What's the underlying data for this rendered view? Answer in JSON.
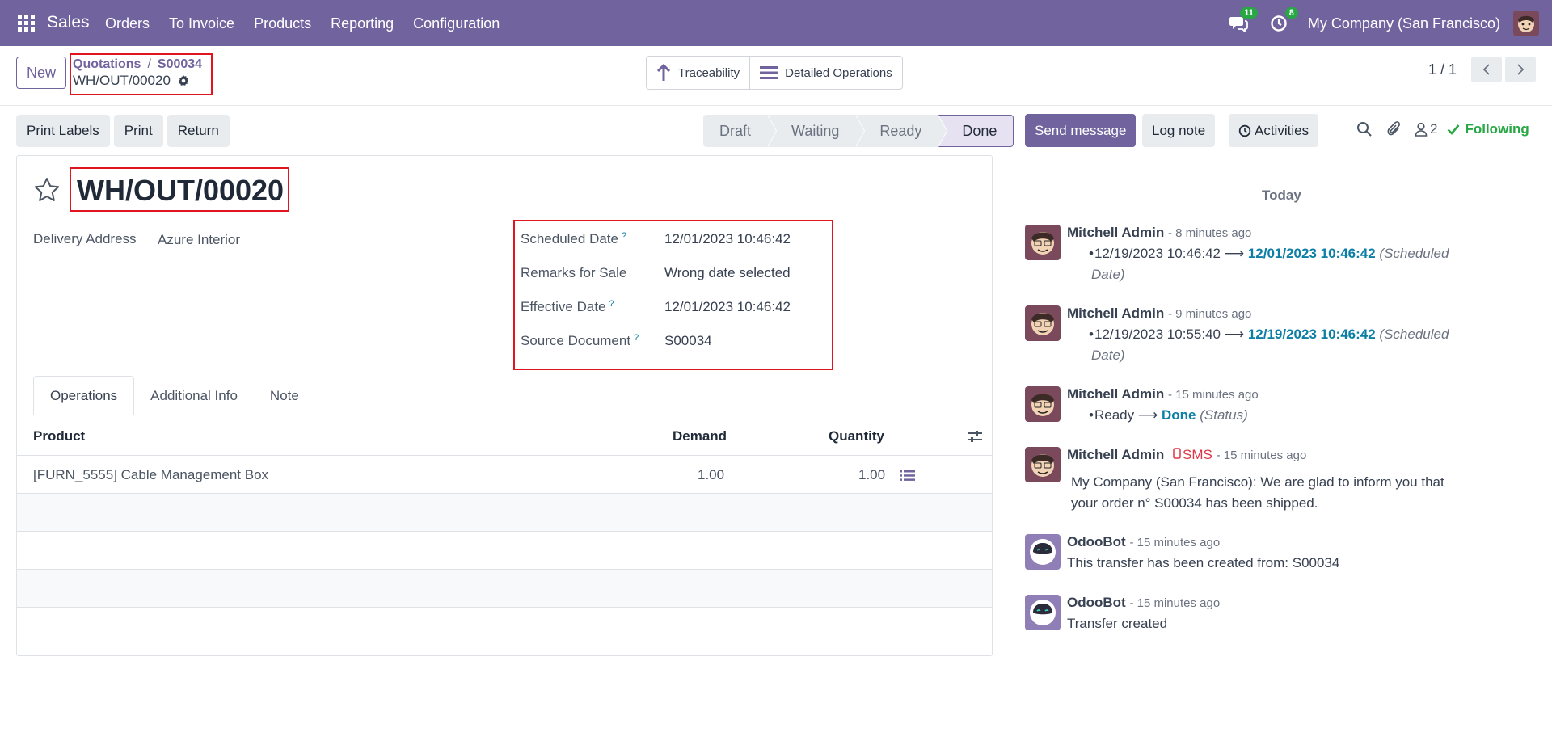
{
  "navbar": {
    "app_name": "Sales",
    "menu": [
      "Orders",
      "To Invoice",
      "Products",
      "Reporting",
      "Configuration"
    ],
    "messages_badge": "11",
    "activities_badge": "8",
    "company": "My Company (San Francisco)"
  },
  "control": {
    "new_label": "New",
    "breadcrumb_parent": "Quotations",
    "breadcrumb_sep": "/",
    "breadcrumb_order": "S00034",
    "record_name": "WH/OUT/00020",
    "traceability_label": "Traceability",
    "detailed_ops_label": "Detailed Operations",
    "pager": "1 / 1"
  },
  "actions": {
    "print_labels": "Print Labels",
    "print": "Print",
    "return": "Return"
  },
  "status": {
    "stages": [
      "Draft",
      "Waiting",
      "Ready",
      "Done"
    ],
    "current": "Done"
  },
  "form": {
    "title": "WH/OUT/00020",
    "delivery_address_label": "Delivery Address",
    "delivery_address_value": "Azure Interior",
    "scheduled_date_label": "Scheduled Date",
    "scheduled_date_value": "12/01/2023 10:46:42",
    "remarks_label": "Remarks for Sale",
    "remarks_value": "Wrong date selected",
    "effective_date_label": "Effective Date",
    "effective_date_value": "12/01/2023 10:46:42",
    "source_document_label": "Source Document",
    "source_document_value": "S00034",
    "help_mark": "?"
  },
  "tabs": [
    "Operations",
    "Additional Info",
    "Note"
  ],
  "table": {
    "headers": {
      "product": "Product",
      "demand": "Demand",
      "quantity": "Quantity"
    },
    "rows": [
      {
        "product": "[FURN_5555] Cable Management Box",
        "demand": "1.00",
        "quantity": "1.00"
      }
    ]
  },
  "chatter": {
    "send_message": "Send message",
    "log_note": "Log note",
    "activities": "Activities",
    "followers_count": "2",
    "following": "Following",
    "today": "Today",
    "messages": [
      {
        "author": "Mitchell Admin",
        "time": "- 8 minutes ago",
        "old": "12/19/2023 10:46:42",
        "arrow": "⟶",
        "new": "12/01/2023 10:46:42",
        "field": "(Scheduled",
        "field2": "Date)"
      },
      {
        "author": "Mitchell Admin",
        "time": "- 9 minutes ago",
        "old": "12/19/2023 10:55:40",
        "arrow": "⟶",
        "new": "12/19/2023 10:46:42",
        "field": "(Scheduled",
        "field2": "Date)"
      },
      {
        "author": "Mitchell Admin",
        "time": "- 15 minutes ago",
        "old": "Ready",
        "arrow": "⟶",
        "new": "Done",
        "field": "(Status)"
      },
      {
        "author": "Mitchell Admin",
        "sms": "SMS",
        "time": "- 15 minutes ago",
        "body1": "My Company (San Francisco): We are glad to inform you that",
        "body2": "your order n° S00034 has been shipped."
      },
      {
        "author": "OdooBot",
        "time": "- 15 minutes ago",
        "body_prefix": "This transfer has been created from: ",
        "body_link": "S00034"
      },
      {
        "author": "OdooBot",
        "time": "- 15 minutes ago",
        "body1": "Transfer created"
      }
    ]
  },
  "colors": {
    "brand": "#71639e",
    "highlight_box": "#e0151d",
    "link": "#0d7ea5",
    "following": "#28a745"
  },
  "icons": [
    "apps-grid-icon",
    "chat-icon",
    "clock-icon",
    "user-avatar",
    "gear-icon",
    "up-arrow-icon",
    "list-icon",
    "chevron-left-icon",
    "chevron-right-icon",
    "star-icon",
    "search-icon",
    "paperclip-icon",
    "user-icon",
    "check-icon",
    "sliders-icon",
    "detail-list-icon",
    "phone-icon"
  ]
}
